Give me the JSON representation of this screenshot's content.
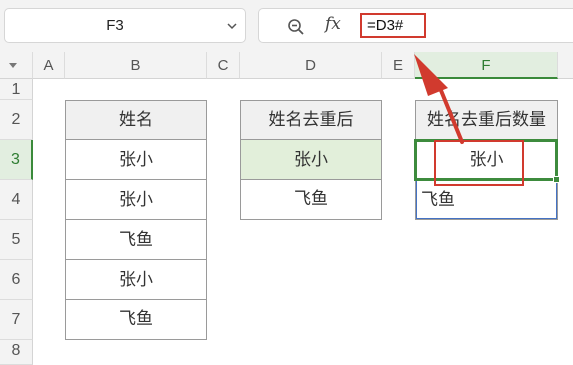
{
  "formula_bar": {
    "name_box": "F3",
    "fx_label": "fx",
    "formula": "=D3#"
  },
  "columns": [
    "A",
    "B",
    "C",
    "D",
    "E",
    "F"
  ],
  "rows": [
    "1",
    "2",
    "3",
    "4",
    "5",
    "6",
    "7",
    "8"
  ],
  "table_b": {
    "header": "姓名",
    "values": [
      "张小",
      "张小",
      "飞鱼",
      "张小",
      "飞鱼"
    ]
  },
  "table_d": {
    "header": "姓名去重后",
    "values": [
      "张小",
      "飞鱼"
    ]
  },
  "table_f": {
    "header": "姓名去重后数量",
    "values": [
      "张小",
      "飞鱼"
    ]
  },
  "colors": {
    "selection": "#3d8b3d",
    "highlight_fill": "#e2efda",
    "annotation_red": "#d13a2e"
  }
}
